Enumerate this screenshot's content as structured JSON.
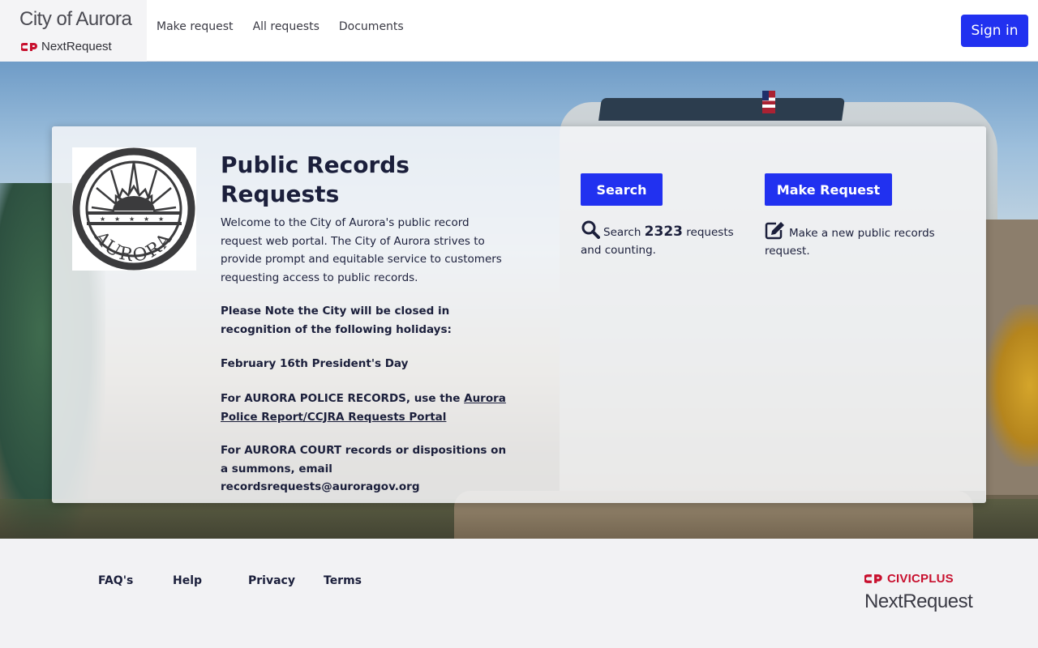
{
  "header": {
    "city_name": "City of Aurora",
    "product_name": "NextRequest",
    "nav": [
      "Make request",
      "All requests",
      "Documents"
    ],
    "sign_in_label": "Sign in"
  },
  "card": {
    "seal_text": "AURORA",
    "title": "Public Records Requests",
    "intro": "Welcome to the City of Aurora's public record request web portal. The City of Aurora strives to provide prompt and equitable service to customers requesting access to public records.",
    "holiday_note": "Please Note the City will be closed in recognition of the following holidays:",
    "holiday": "February 16th President's Day",
    "police_prefix": "For AURORA POLICE RECORDS, use the ",
    "police_link": "Aurora Police Report/CCJRA Requests Portal",
    "court_note": "For AURORA COURT records or dispositions on a summons, email recordsrequests@auroragov.org",
    "search": {
      "button_label": "Search",
      "desc_prefix": "Search ",
      "count": "2323",
      "desc_suffix": " requests and counting.",
      "icon": "search-icon"
    },
    "make_request": {
      "button_label": "Make Request",
      "desc": "Make a new public records request.",
      "icon": "edit-icon"
    }
  },
  "footer": {
    "links": [
      "FAQ's",
      "Help",
      "Privacy",
      "Terms"
    ],
    "brand_top": "CIVICPLUS",
    "brand_bottom": "NextRequest"
  },
  "colors": {
    "primary": "#2131f0",
    "text": "#1b1f3b",
    "brand_red": "#c8102e"
  }
}
